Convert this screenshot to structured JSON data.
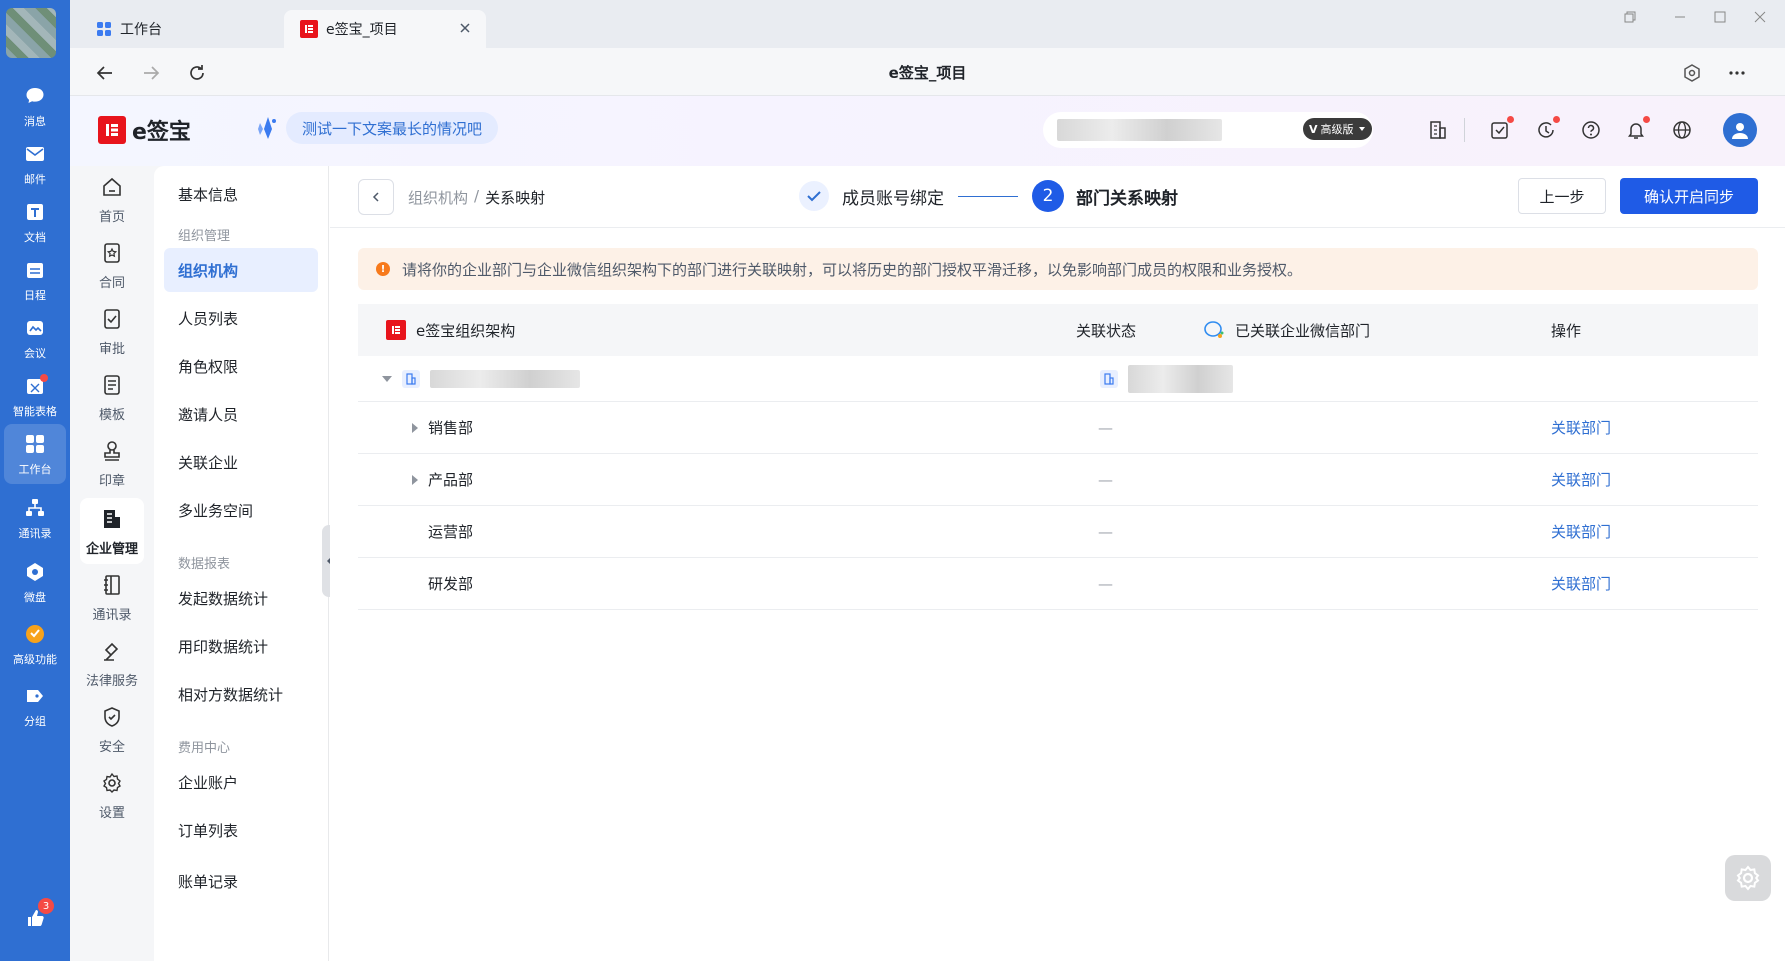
{
  "rail": {
    "items": [
      {
        "label": "消息"
      },
      {
        "label": "邮件"
      },
      {
        "label": "文档"
      },
      {
        "label": "日程"
      },
      {
        "label": "会议"
      },
      {
        "label": "智能表格"
      },
      {
        "label": "工作台"
      },
      {
        "label": "通讯录"
      },
      {
        "label": "微盘"
      },
      {
        "label": "高级功能"
      },
      {
        "label": "分组"
      }
    ],
    "badge_count": "3"
  },
  "browser": {
    "tabs": [
      {
        "label": "工作台"
      },
      {
        "label": "e签宝_项目"
      }
    ],
    "page_title": "e签宝_项目"
  },
  "app_header": {
    "logo_text": "e签宝",
    "ai_prompt": "测试一下文案最长的情况吧",
    "vip_label": "高级版"
  },
  "modules": [
    {
      "label": "首页",
      "icon": "home-icon"
    },
    {
      "label": "合同",
      "icon": "contract-icon"
    },
    {
      "label": "审批",
      "icon": "approval-icon"
    },
    {
      "label": "模板",
      "icon": "template-icon"
    },
    {
      "label": "印章",
      "icon": "seal-icon"
    },
    {
      "label": "企业管理",
      "icon": "enterprise-icon"
    },
    {
      "label": "通讯录",
      "icon": "address-book-icon"
    },
    {
      "label": "法律服务",
      "icon": "legal-icon"
    },
    {
      "label": "安全",
      "icon": "shield-icon"
    },
    {
      "label": "设置",
      "icon": "gear-icon"
    }
  ],
  "submenu": {
    "basic_info": "基本信息",
    "group_org": "组织管理",
    "org_items": [
      "组织机构",
      "人员列表",
      "角色权限",
      "邀请人员",
      "关联企业",
      "多业务空间"
    ],
    "group_report": "数据报表",
    "report_items": [
      "发起数据统计",
      "用印数据统计",
      "相对方数据统计"
    ],
    "group_fee": "费用中心",
    "fee_items": [
      "企业账户",
      "订单列表",
      "账单记录"
    ]
  },
  "topbar": {
    "crumb_parent": "组织机构",
    "crumb_sep": "/",
    "crumb_current": "关系映射",
    "step1": "成员账号绑定",
    "step2_num": "2",
    "step2": "部门关系映射",
    "prev_button": "上一步",
    "confirm_button": "确认开启同步"
  },
  "alert": "请将你的企业部门与企业微信组织架构下的部门进行关联映射，可以将历史的部门授权平滑迁移，以免影响部门成员的权限和业务授权。",
  "table": {
    "headers": {
      "esign_org": "e签宝组织架构",
      "status": "关联状态",
      "wecom_dept": "已关联企业微信部门",
      "action": "操作"
    },
    "rows": [
      {
        "name": "销售部",
        "status": "—",
        "action": "关联部门"
      },
      {
        "name": "产品部",
        "status": "—",
        "action": "关联部门"
      },
      {
        "name": "运营部",
        "status": "—",
        "action": "关联部门"
      },
      {
        "name": "研发部",
        "status": "—",
        "action": "关联部门"
      }
    ]
  },
  "colors": {
    "rail_blue": "#2f6fd2",
    "primary": "#1f5be6",
    "brand_red": "#e8141c",
    "alert_bg": "#fdf1e7",
    "alert_icon": "#f77a1c"
  }
}
